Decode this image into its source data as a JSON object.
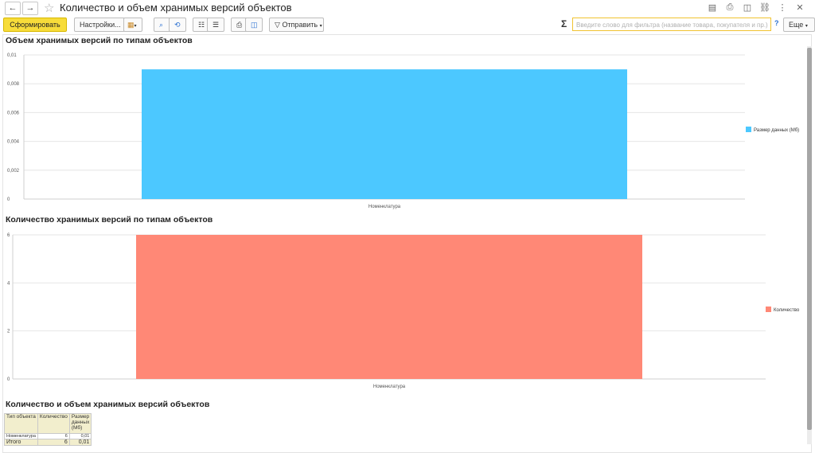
{
  "window": {
    "title": "Количество и объем хранимых версий объектов",
    "back_glyph": "←",
    "forward_glyph": "→",
    "star_glyph": "☆",
    "top_icons": [
      "save-icon",
      "print-icon",
      "preview-icon",
      "link-icon",
      "more-vertical-icon",
      "close-icon"
    ]
  },
  "toolbar": {
    "generate_label": "Сформировать",
    "settings_label": "Настройки...",
    "send_label": "Отправить",
    "more_label": "Еще",
    "sigma": "Σ",
    "search_placeholder": "Введите слово для фильтра (название товара, покупателя и пр.)",
    "help": "?"
  },
  "colors": {
    "accent_yellow": "#f7dc3a",
    "series1": "#4cc8ff",
    "series2": "#ff8876"
  },
  "chart_data": [
    {
      "type": "bar",
      "title": "Объем хранимых версий по типам объектов",
      "categories": [
        "Номенклатура"
      ],
      "series": [
        {
          "name": "Размер данных (Мб)",
          "values": [
            0.009
          ]
        }
      ],
      "ylim": [
        0,
        0.01
      ],
      "yticks": [
        "0",
        "0,002",
        "0,004",
        "0,006",
        "0,008",
        "0,01"
      ],
      "legend": "right",
      "grid": true
    },
    {
      "type": "bar",
      "title": "Количество хранимых версий по типам объектов",
      "categories": [
        "Номенклатура"
      ],
      "series": [
        {
          "name": "Количество",
          "values": [
            6
          ]
        }
      ],
      "ylim": [
        0,
        6
      ],
      "yticks": [
        "0",
        "2",
        "4",
        "6"
      ],
      "legend": "right",
      "grid": true
    }
  ],
  "table": {
    "title": "Количество и объем хранимых версий объектов",
    "headers": [
      "Тип объекта",
      "Количество",
      "Размер данных (Мб)"
    ],
    "rows": [
      [
        "Номенклатура",
        "6",
        "0,01"
      ]
    ],
    "total": [
      "Итого",
      "6",
      "0,01"
    ]
  }
}
